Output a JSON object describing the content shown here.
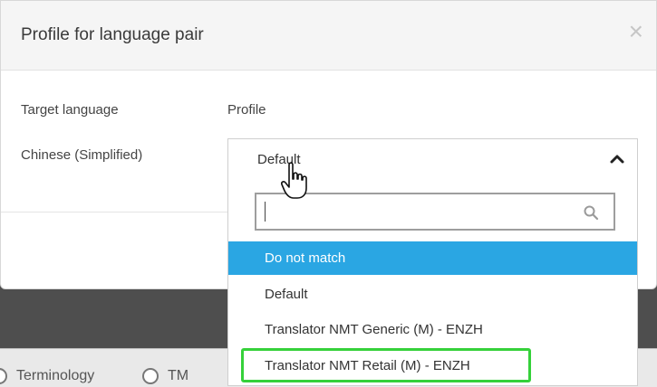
{
  "dialog": {
    "title": "Profile for language pair",
    "close_symbol": "×"
  },
  "table": {
    "headers": [
      "Target language",
      "Profile"
    ],
    "row": {
      "language": "Chinese (Simplified)",
      "profile_value": "Default"
    }
  },
  "dropdown": {
    "search_value": "",
    "options": [
      {
        "label": "Do not match",
        "state": "hovered"
      },
      {
        "label": "Default",
        "state": "normal"
      },
      {
        "label": "Translator NMT Generic (M) - ENZH",
        "state": "normal"
      },
      {
        "label": "Translator NMT Retail (M) - ENZH",
        "state": "outlined"
      }
    ]
  },
  "background": {
    "radio_labels": [
      "Terminology",
      "TM"
    ]
  },
  "icons": {
    "close": "close-icon",
    "chevron": "chevron-up-icon",
    "search": "search-icon",
    "cursor": "cursor-hand-icon"
  },
  "colors": {
    "option_hover": "#2aa6e3",
    "highlight_outline": "#35d13a",
    "backdrop": "#4e4e4e"
  }
}
